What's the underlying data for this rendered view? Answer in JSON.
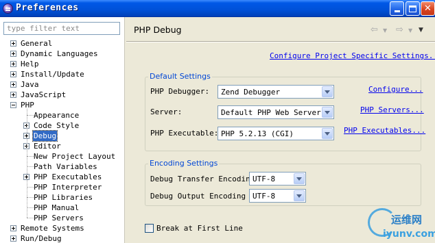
{
  "window": {
    "title": "Preferences"
  },
  "sidebar": {
    "filter_placeholder": "type filter text",
    "items": [
      {
        "label": "General",
        "level": 0,
        "expander": "plus"
      },
      {
        "label": "Dynamic Languages",
        "level": 0,
        "expander": "plus"
      },
      {
        "label": "Help",
        "level": 0,
        "expander": "plus"
      },
      {
        "label": "Install/Update",
        "level": 0,
        "expander": "plus"
      },
      {
        "label": "Java",
        "level": 0,
        "expander": "plus"
      },
      {
        "label": "JavaScript",
        "level": 0,
        "expander": "plus"
      },
      {
        "label": "PHP",
        "level": 0,
        "expander": "minus"
      },
      {
        "label": "Appearance",
        "level": 1,
        "expander": "none"
      },
      {
        "label": "Code Style",
        "level": 1,
        "expander": "plus"
      },
      {
        "label": "Debug",
        "level": 1,
        "expander": "plus",
        "selected": true
      },
      {
        "label": "Editor",
        "level": 1,
        "expander": "plus"
      },
      {
        "label": "New Project Layout",
        "level": 1,
        "expander": "none"
      },
      {
        "label": "Path Variables",
        "level": 1,
        "expander": "none"
      },
      {
        "label": "PHP Executables",
        "level": 1,
        "expander": "plus"
      },
      {
        "label": "PHP Interpreter",
        "level": 1,
        "expander": "none"
      },
      {
        "label": "PHP Libraries",
        "level": 1,
        "expander": "none"
      },
      {
        "label": "PHP Manual",
        "level": 1,
        "expander": "none"
      },
      {
        "label": "PHP Servers",
        "level": 1,
        "expander": "none"
      },
      {
        "label": "Remote Systems",
        "level": 0,
        "expander": "plus"
      },
      {
        "label": "Run/Debug",
        "level": 0,
        "expander": "plus"
      }
    ]
  },
  "page": {
    "title": "PHP Debug",
    "configure_project_link": "Configure Project Specific Settings...",
    "default_settings": {
      "title": "Default Settings",
      "debugger_label": "PHP Debugger:",
      "debugger_value": "Zend Debugger",
      "debugger_link": "Configure...",
      "server_label": "Server:",
      "server_value": "Default PHP Web Server",
      "server_link": "PHP Servers...",
      "executable_label": "PHP Executable:",
      "executable_value": "PHP 5.2.13 (CGI)",
      "executable_link": "PHP Executables..."
    },
    "encoding_settings": {
      "title": "Encoding Settings",
      "transfer_label": "Debug Transfer Encoding",
      "transfer_value": "UTF-8",
      "output_label": "Debug Output Encoding",
      "output_value": "UTF-8"
    },
    "break_first_line_label": "Break at First Line"
  },
  "watermark": {
    "line1": "运维网",
    "line2": "iyunv.com"
  },
  "colors": {
    "titlebar": "#0058e6",
    "link": "#0000ee",
    "group_title": "#0046d5",
    "selection": "#316ac5",
    "panel_bg": "#ece9d8"
  }
}
